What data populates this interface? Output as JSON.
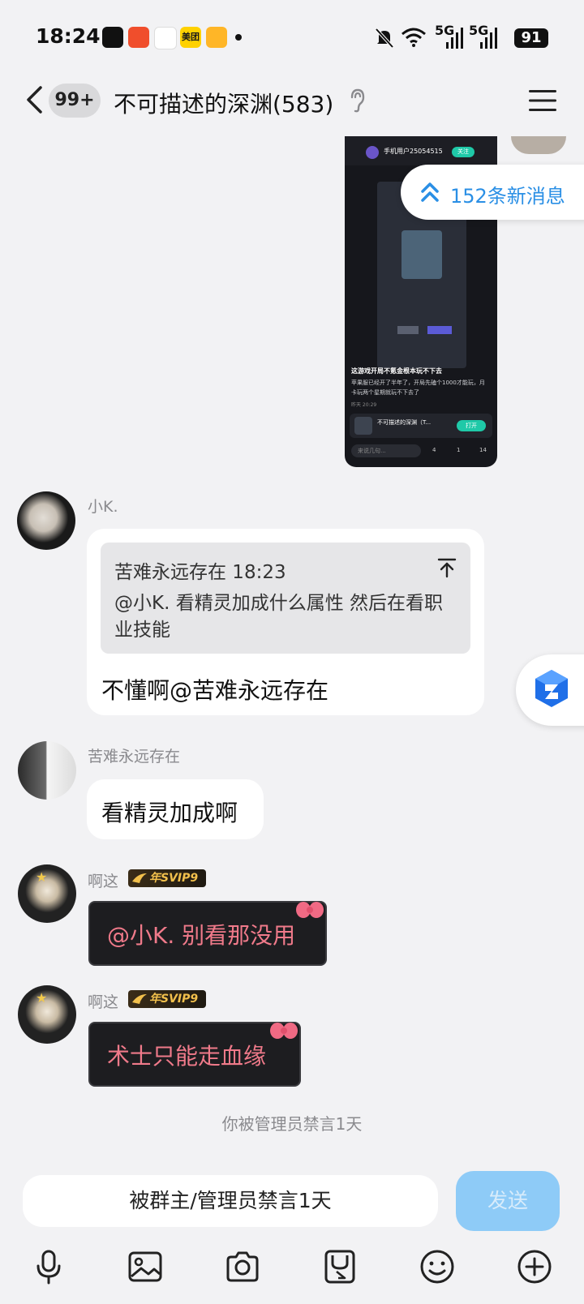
{
  "status_bar": {
    "time": "18:24",
    "network_1": "5G",
    "network_2": "5G",
    "battery": "91"
  },
  "header": {
    "unread_badge": "99+",
    "title": "不可描述的深渊(583)"
  },
  "new_messages_pill": {
    "text": "152条新消息"
  },
  "messages": [
    {
      "sender": "小K.",
      "quote": {
        "author_time": "苦难永远存在 18:23",
        "text": "@小K. 看精灵加成什么属性 然后在看职业技能"
      },
      "text": "不懂啊@苦难永远存在"
    },
    {
      "sender": "苦难永远存在",
      "text": "看精灵加成啊"
    },
    {
      "sender": "啊这",
      "badge": "年SVIP9",
      "text": "@小K. 别看那没用"
    },
    {
      "sender": "啊这",
      "badge": "年SVIP9",
      "text": "术士只能走血缘"
    }
  ],
  "system_notice": "你被管理员禁言1天",
  "input": {
    "text": "被群主/管理员禁言1天",
    "send_label": "发送"
  },
  "screenshot_card": {
    "post_title": "这游戏开局不氪金根本玩不下去",
    "post_body": "苹果服已经开了半年了，开局先磕个1000才能玩，月卡玩两个星期就玩不下去了",
    "post_time": "昨天 20:29",
    "user": "手机用户25054515",
    "follow_label": "关注",
    "game_name": "不可描述的深渊（T...",
    "open_label": "打开",
    "comment_placeholder": "来说几句...",
    "likes": "4",
    "stars": "1",
    "comments": "14"
  },
  "colors": {
    "accent": "#2a8fe5",
    "send_button": "#8ecbf7",
    "vip_text": "#f07a8a",
    "background": "#f2f2f4"
  },
  "icons": [
    "back-arrow-icon",
    "ear-icon",
    "menu-icon",
    "double-chevron-up-icon",
    "jump-to-top-icon",
    "voice-icon",
    "image-icon",
    "camera-icon",
    "sticker-icon",
    "emoji-icon",
    "plus-icon"
  ]
}
